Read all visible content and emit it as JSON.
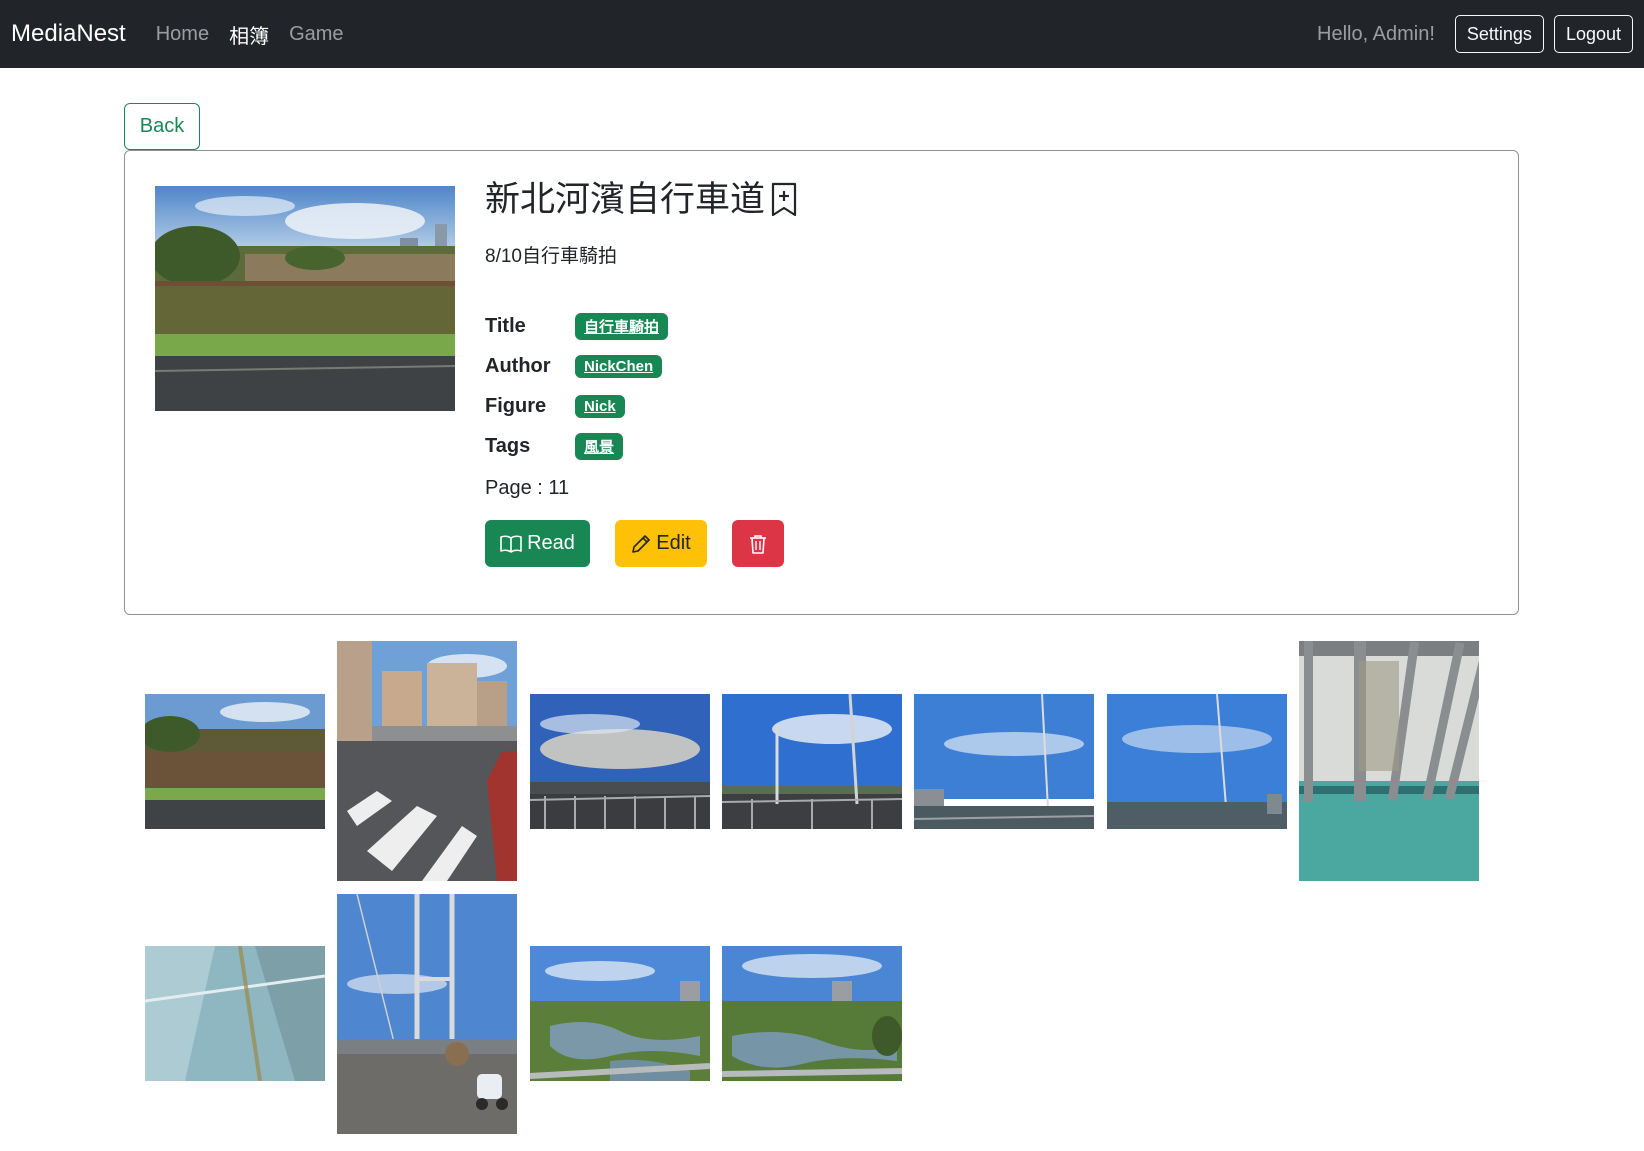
{
  "navbar": {
    "brand": "MediaNest",
    "links": [
      "Home",
      "相簿",
      "Game"
    ],
    "greeting": "Hello, Admin!",
    "settings_label": "Settings",
    "logout_label": "Logout"
  },
  "back_label": "Back",
  "album": {
    "title": "新北河濱自行車道",
    "subtitle": "8/10自行車騎拍",
    "meta": [
      {
        "label": "Title",
        "value": "自行車騎拍"
      },
      {
        "label": "Author",
        "value": "NickChen"
      },
      {
        "label": "Figure",
        "value": "Nick"
      },
      {
        "label": "Tags",
        "value": "風景"
      }
    ],
    "page_text": "Page : 11",
    "read_label": "Read",
    "edit_label": "Edit"
  },
  "colors": {
    "navbar_bg": "#212529",
    "success": "#198754",
    "warning": "#ffc107",
    "danger": "#dc3545"
  },
  "icons": {
    "bookmark": "bookmark-plus-icon",
    "read": "book-icon",
    "edit": "pencil-icon",
    "delete": "trash-icon"
  },
  "gallery": {
    "photo_count": 11
  }
}
